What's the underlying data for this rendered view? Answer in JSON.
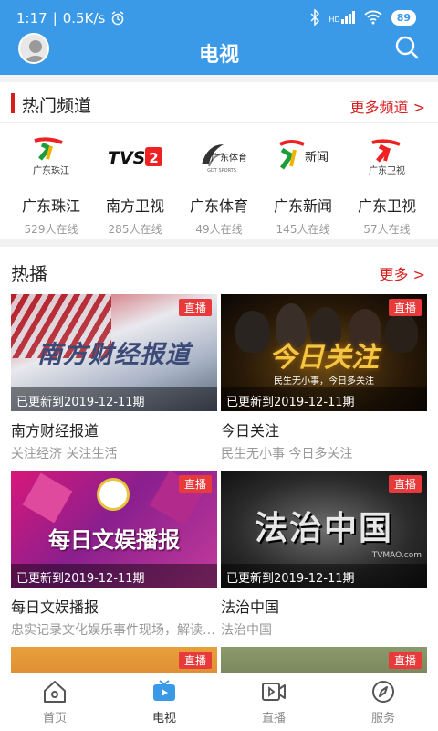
{
  "status": {
    "time": "1:17",
    "speed": "0.5K/s",
    "battery": "89",
    "signal": "HD"
  },
  "nav": {
    "title": "电视"
  },
  "hot_channels": {
    "title": "热门频道",
    "more": "更多频道 >",
    "items": [
      {
        "name": "广东珠江",
        "count": "529人在线",
        "logo_text": "广东珠江"
      },
      {
        "name": "南方卫视",
        "count": "285人在线",
        "logo_text": "TVS2"
      },
      {
        "name": "广东体育",
        "count": "49人在线",
        "logo_text": "广东体育",
        "logo_sub": "GDT SPORTS"
      },
      {
        "name": "广东新闻",
        "count": "145人在线",
        "logo_text": "新闻"
      },
      {
        "name": "广东卫视",
        "count": "57人在线",
        "logo_text": "广东卫视"
      }
    ]
  },
  "hot": {
    "title": "热播",
    "more": "更多 >",
    "items": [
      {
        "title": "南方财经报道",
        "subtitle": "关注经济 关注生活",
        "badge": "直播",
        "update": "已更新到2019-12-11期",
        "thumb_text": "南方财经报道"
      },
      {
        "title": "今日关注",
        "subtitle": "民生无小事 今日多关注",
        "badge": "直播",
        "update": "已更新到2019-12-11期",
        "thumb_text": "今日关注",
        "thumb_sub": "民生无小事，今日多关注"
      },
      {
        "title": "每日文娱播报",
        "subtitle": "忠实记录文化娱乐事件现场，解读…",
        "badge": "直播",
        "update": "已更新到2019-12-11期",
        "thumb_text": "每日文娱播报"
      },
      {
        "title": "法治中国",
        "subtitle": "法治中国",
        "badge": "直播",
        "update": "已更新到2019-12-11期",
        "thumb_text": "法治中国",
        "thumb_sub": "TVMAO.com"
      },
      {
        "badge": "直播"
      },
      {
        "badge": "直播"
      }
    ]
  },
  "tabs": [
    {
      "label": "首页",
      "icon": "home-icon"
    },
    {
      "label": "电视",
      "icon": "tv-icon"
    },
    {
      "label": "直播",
      "icon": "live-icon"
    },
    {
      "label": "服务",
      "icon": "compass-icon"
    }
  ],
  "colors": {
    "primary": "#3a9ae8",
    "accent": "#d71e1e",
    "badge": "#e83a3a"
  }
}
